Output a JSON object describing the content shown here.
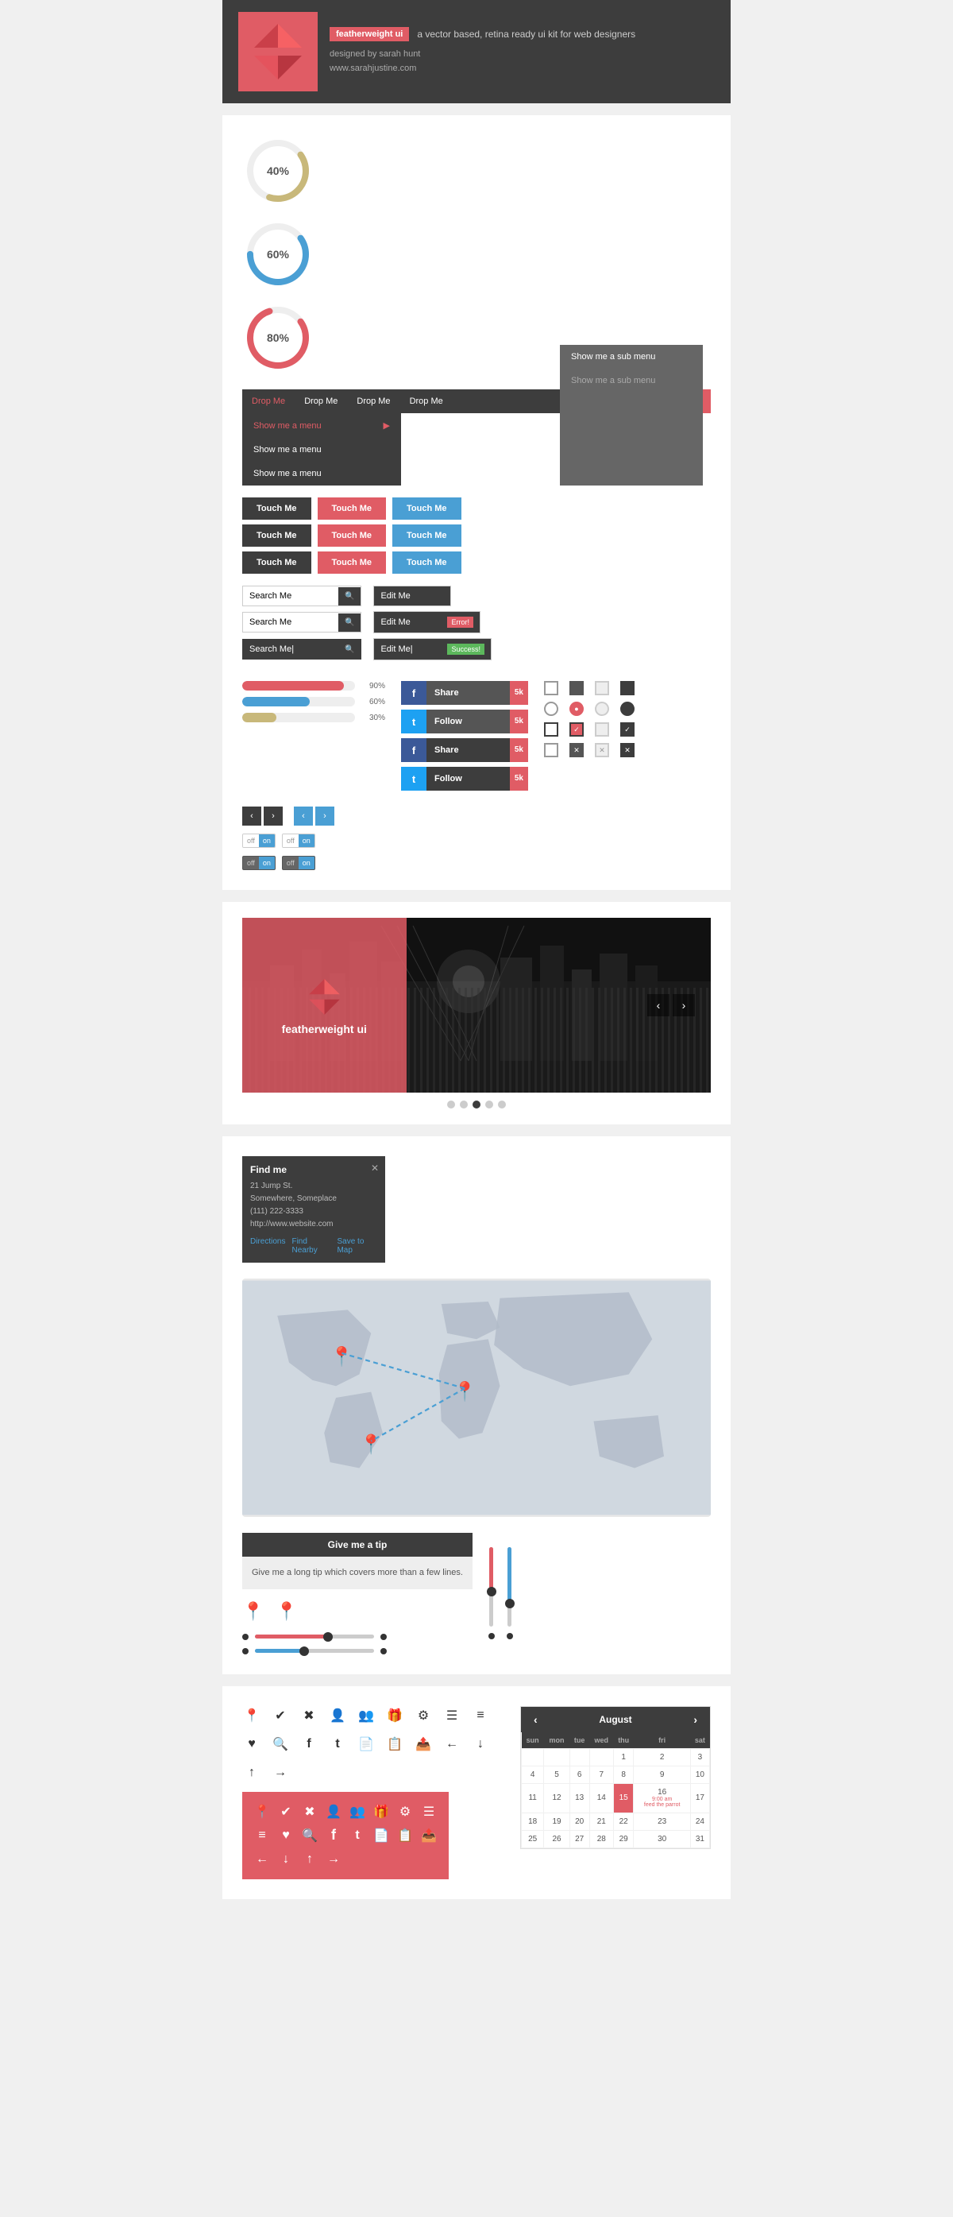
{
  "header": {
    "brand": "featherweight ui",
    "tagline": "a vector based, retina ready ui kit for web designers",
    "designer": "designed by sarah hunt",
    "website": "www.sarahjustine.com"
  },
  "charts": [
    {
      "percent": 40,
      "color": "#c8b87a",
      "label": "40%"
    },
    {
      "percent": 60,
      "color": "#4a9fd4",
      "label": "60%"
    },
    {
      "percent": 80,
      "color": "#e05c65",
      "label": "80%"
    }
  ],
  "dropdown": {
    "items": [
      "Drop Me",
      "Drop Me",
      "Drop Me",
      "Drop Me"
    ],
    "active": "Drop Me",
    "menu": [
      "Show me a menu",
      "Show me a menu",
      "Show me a menu"
    ],
    "submenu": [
      "Show me a sub menu",
      "Show me a sub menu"
    ]
  },
  "buttons": {
    "rows": [
      [
        "Touch Me",
        "Touch Me",
        "Touch Me"
      ],
      [
        "Touch Me",
        "Touch Me",
        "Touch Me"
      ],
      [
        "Touch Me",
        "Touch Me",
        "Touch Me"
      ]
    ]
  },
  "inputs": {
    "search_placeholder": "Search Me",
    "edit_placeholder": "Edit Me",
    "search_rows": [
      "Search Me",
      "Search Me",
      "Search Me|"
    ],
    "edit_rows": [
      "Edit Me",
      "Edit Me",
      "Edit Me|"
    ],
    "badges": [
      "",
      "Error!",
      "Success!"
    ]
  },
  "progress_bars": [
    {
      "label": "90%",
      "percent": 90,
      "color": "#e05c65"
    },
    {
      "label": "60%",
      "percent": 60,
      "color": "#4a9fd4"
    },
    {
      "label": "30%",
      "percent": 30,
      "color": "#c8b87a"
    }
  ],
  "social": {
    "buttons": [
      {
        "network": "f",
        "action": "Share",
        "count": "5k",
        "style": "light"
      },
      {
        "network": "t",
        "action": "Follow",
        "count": "5k",
        "style": "light"
      },
      {
        "network": "f",
        "action": "Share",
        "count": "5k",
        "style": "dark"
      },
      {
        "network": "t",
        "action": "Follow",
        "count": "5k",
        "style": "dark"
      }
    ]
  },
  "toggles": [
    {
      "off": "off",
      "on": "on",
      "state": "off",
      "style": "light"
    },
    {
      "off": "off",
      "on": "on",
      "state": "on",
      "style": "light"
    },
    {
      "off": "off",
      "on": "on",
      "state": "off",
      "style": "dark"
    },
    {
      "off": "off",
      "on": "on",
      "state": "on",
      "style": "dark"
    }
  ],
  "pagination": {
    "prev": "‹",
    "next": "›"
  },
  "banner": {
    "title": "featherweight ui",
    "dots": 5,
    "active_dot": 2
  },
  "map_card": {
    "title": "Find me",
    "address": "21 Jump St.",
    "city": "Somewhere, Someplace",
    "phone": "(111) 222-3333",
    "website": "http://www.website.com",
    "links": [
      "Directions",
      "Find Nearby",
      "Save to Map"
    ]
  },
  "tip": {
    "header": "Give me a tip",
    "body": "Give me a long tip which covers more than a few lines."
  },
  "calendar": {
    "month": "August",
    "year": "",
    "days_header": [
      "sun",
      "mon",
      "tue",
      "wed",
      "thu",
      "fri",
      "sat"
    ],
    "weeks": [
      [
        "",
        "",
        "",
        "",
        "1",
        "2",
        "3",
        "4",
        "5"
      ],
      [
        "6",
        "7",
        "8",
        "9",
        "10",
        "11",
        "12"
      ],
      [
        "13",
        "14",
        "15",
        "16",
        "17",
        "18",
        "19"
      ],
      [
        "20",
        "21",
        "22",
        "23",
        "24",
        "25",
        "26"
      ],
      [
        "27",
        "28",
        "29",
        "30",
        "31",
        "",
        ""
      ]
    ],
    "event": {
      "day": "15",
      "time": "9:00 am",
      "label": "feed the parrot"
    }
  },
  "icons": [
    "📍",
    "✔",
    "✖",
    "👤",
    "👥",
    "🎁",
    "⚙",
    "☰",
    "≡",
    "❤",
    "🔍",
    "f",
    "t",
    "📄",
    "📋",
    "📤",
    "←",
    "↓",
    "↑",
    "→"
  ],
  "icon_labels": [
    "location",
    "check",
    "close",
    "user",
    "users",
    "gift",
    "gear",
    "list",
    "bullets",
    "heart",
    "search",
    "facebook",
    "twitter",
    "file",
    "doc",
    "upload",
    "arrow-left",
    "arrow-down",
    "arrow-up",
    "arrow-right"
  ]
}
